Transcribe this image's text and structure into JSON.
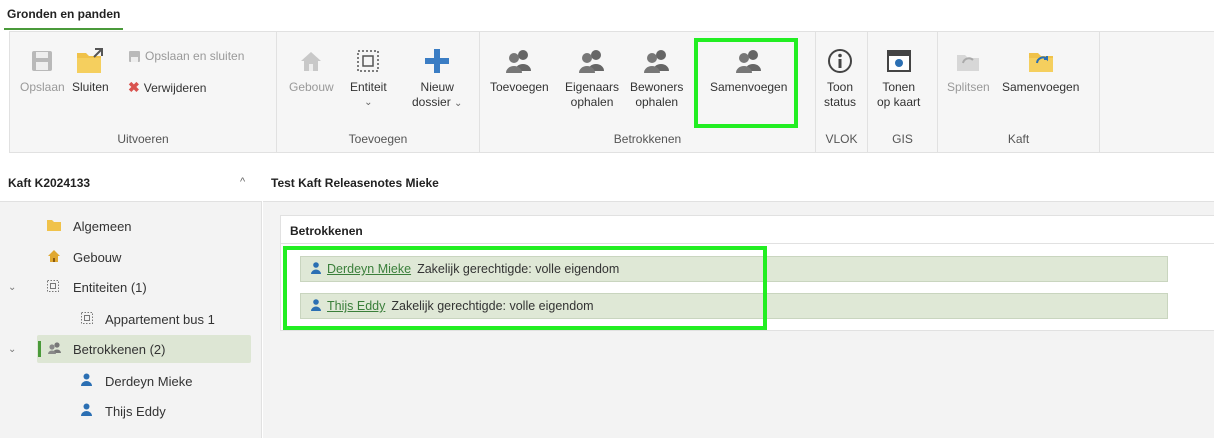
{
  "tab": {
    "label": "Gronden en panden"
  },
  "ribbon": {
    "uitvoeren": {
      "label": "Uitvoeren",
      "opslaan": "Opslaan",
      "sluiten": "Sluiten",
      "opslaan_en_sluiten": "Opslaan en sluiten",
      "verwijderen": "Verwijderen"
    },
    "toevoegen": {
      "label": "Toevoegen",
      "gebouw": "Gebouw",
      "entiteit": "Entiteit",
      "nieuw_dossier_1": "Nieuw",
      "nieuw_dossier_2": "dossier"
    },
    "betrokkenen": {
      "label": "Betrokkenen",
      "toevoegen": "Toevoegen",
      "eigenaars_1": "Eigenaars",
      "eigenaars_2": "ophalen",
      "bewoners_1": "Bewoners",
      "bewoners_2": "ophalen",
      "samenvoegen": "Samenvoegen"
    },
    "vlok": {
      "label": "VLOK",
      "toon_1": "Toon",
      "toon_2": "status"
    },
    "gis": {
      "label": "GIS",
      "tonen_1": "Tonen",
      "tonen_2": "op kaart"
    },
    "kaft": {
      "label": "Kaft",
      "splitsen": "Splitsen",
      "samenvoegen": "Samenvoegen"
    }
  },
  "left": {
    "title": "Kaft K2024133",
    "tree": {
      "algemeen": "Algemeen",
      "gebouw": "Gebouw",
      "entiteiten": "Entiteiten (1)",
      "appartement": "Appartement bus 1",
      "betrokkenen": "Betrokkenen (2)",
      "derdeyn": "Derdeyn Mieke",
      "thijs": "Thijs Eddy"
    }
  },
  "main": {
    "title": "Test Kaft Releasenotes Mieke",
    "card_title": "Betrokkenen",
    "persons": [
      {
        "name": "Derdeyn Mieke",
        "role": "Zakelijk gerechtigde: volle eigendom"
      },
      {
        "name": "Thijs Eddy",
        "role": "Zakelijk gerechtigde: volle eigendom"
      }
    ]
  },
  "colors": {
    "accent": "#4a9a3a",
    "highlight": "#22ee22",
    "person_icon": "#2b6fb3",
    "folder": "#f0c24a"
  }
}
